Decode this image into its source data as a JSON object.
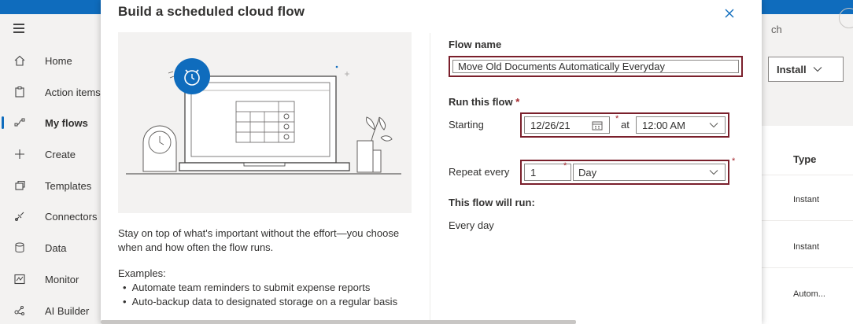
{
  "nav": {
    "items": [
      {
        "label": "Home",
        "icon": "home-icon"
      },
      {
        "label": "Action items",
        "icon": "clipboard-icon"
      },
      {
        "label": "My flows",
        "icon": "flow-icon",
        "active": true
      },
      {
        "label": "Create",
        "icon": "plus-icon"
      },
      {
        "label": "Templates",
        "icon": "templates-icon"
      },
      {
        "label": "Connectors",
        "icon": "connector-icon"
      },
      {
        "label": "Data",
        "icon": "database-icon"
      },
      {
        "label": "Monitor",
        "icon": "monitor-icon"
      },
      {
        "label": "AI Builder",
        "icon": "ai-builder-icon"
      }
    ]
  },
  "background": {
    "search_fragment": "ch",
    "install_label": "Install",
    "type_header": "Type",
    "rows": [
      "Instant",
      "Instant",
      "Autom..."
    ]
  },
  "dialog": {
    "title": "Build a scheduled cloud flow",
    "description": "Stay on top of what's important without the effort—you choose when and how often the flow runs.",
    "examples_label": "Examples:",
    "examples": [
      "Automate team reminders to submit expense reports",
      "Auto-backup data to designated storage on a regular basis"
    ],
    "flow_name_label": "Flow name",
    "flow_name_value": "Move Old Documents Automatically Everyday",
    "run_label": "Run this flow",
    "required_mark": "*",
    "starting_label": "Starting",
    "start_date": "12/26/21",
    "at_label": "at",
    "start_time": "12:00 AM",
    "repeat_label": "Repeat every",
    "interval": "1",
    "frequency": "Day",
    "will_run_label": "This flow will run:",
    "will_run_value": "Every day"
  },
  "colors": {
    "accent": "#0f6cbd",
    "highlight_border": "#7a1f2b",
    "required": "#a4262c"
  }
}
